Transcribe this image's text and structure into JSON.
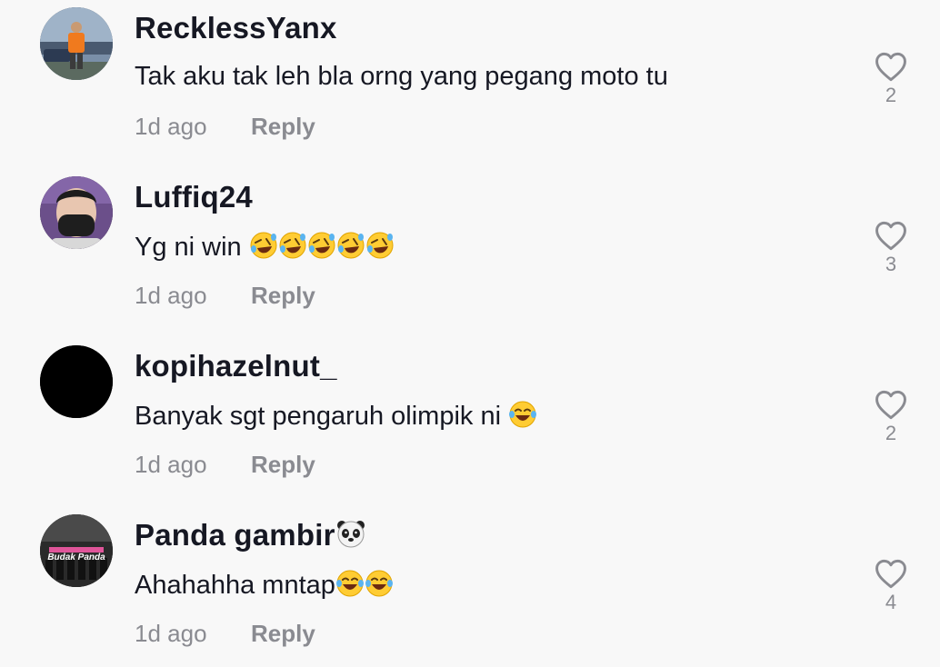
{
  "comments": [
    {
      "username": "RecklessYanx",
      "text": "Tak aku tak leh bla orng yang pegang moto tu",
      "emojis": [],
      "time": "1d ago",
      "reply_label": "Reply",
      "likes": "2",
      "avatar": "person-photo"
    },
    {
      "username": "Luffiq24",
      "text": "Yg ni win ",
      "emojis": [
        "rolling-laugh",
        "rolling-laugh",
        "rolling-laugh",
        "rolling-laugh",
        "rolling-laugh"
      ],
      "time": "1d ago",
      "reply_label": "Reply",
      "likes": "3",
      "avatar": "masked-person-photo"
    },
    {
      "username": "kopihazelnut_",
      "text": "Banyak sgt pengaruh olimpik ni ",
      "emojis": [
        "tears-of-joy"
      ],
      "time": "1d ago",
      "reply_label": "Reply",
      "likes": "2",
      "avatar": "black-circle"
    },
    {
      "username": "Panda gambir",
      "username_emoji": "panda-face",
      "text": "Ahahahha mntap",
      "emojis": [
        "tears-of-joy",
        "tears-of-joy"
      ],
      "time": "1d ago",
      "reply_label": "Reply",
      "likes": "4",
      "avatar": "group-photo",
      "avatar_text": "Budak Panda"
    }
  ],
  "colors": {
    "background": "#f8f8f8",
    "username": "#161823",
    "meta": "#8a8b91",
    "heart": "#8a8b91"
  }
}
